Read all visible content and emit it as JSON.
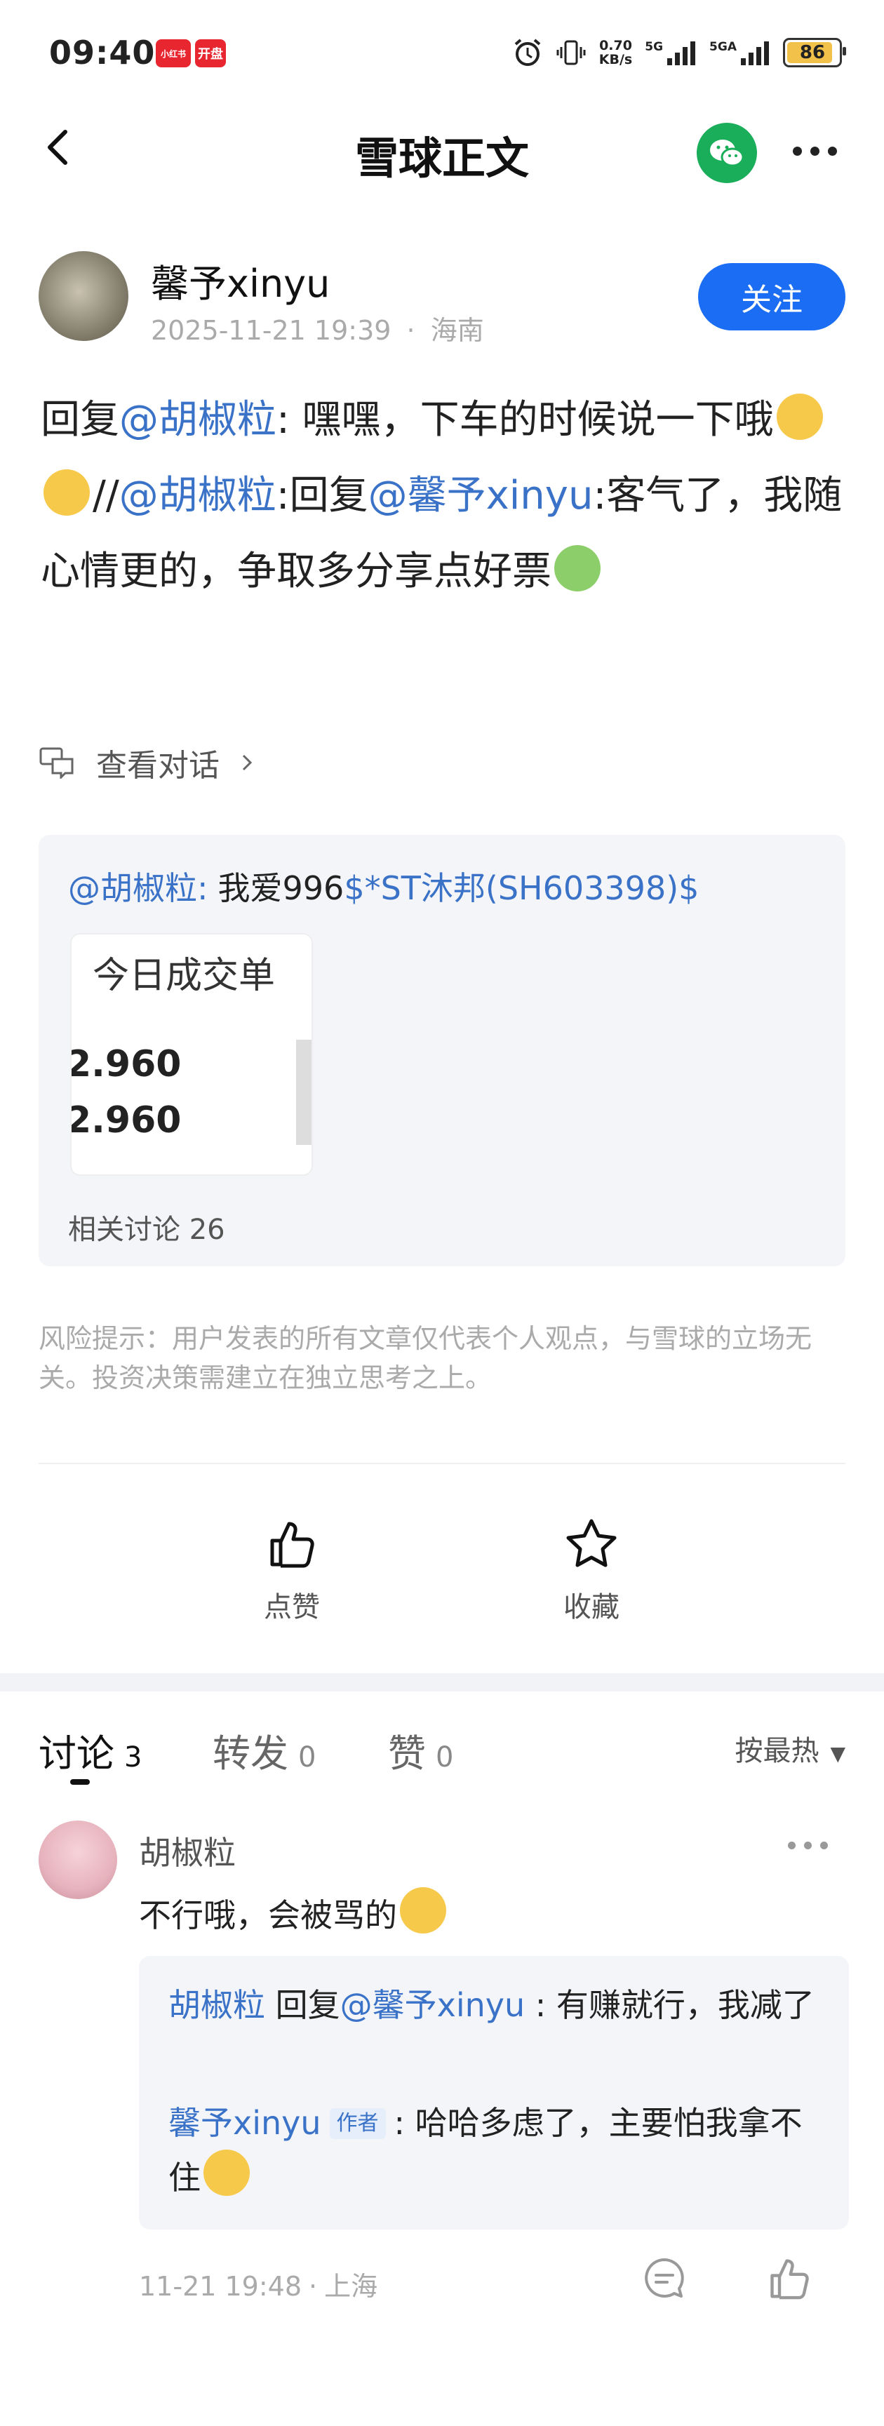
{
  "status_bar": {
    "time": "09:40",
    "badges": [
      "小红书",
      "开盘"
    ],
    "net_speed": "0.70",
    "net_unit": "KB/s",
    "sim1": "5G",
    "sim2": "5GA",
    "battery": "86",
    "battery_color": "#f2c14a"
  },
  "nav": {
    "title": "雪球正文"
  },
  "author": {
    "name": "馨予xinyu",
    "date": "2025-11-21 19:39",
    "location": "海南",
    "follow_label": "关注"
  },
  "post": {
    "p1": "回复",
    "m1": "@胡椒粒",
    "p2": ": 嘿嘿，下车的时候说一下哦",
    "p3": "//",
    "m2": "@胡椒粒",
    "p4": ":回复",
    "m3": "@馨予xinyu",
    "p5": ":客气了，我随心情更的，争取多分享点好票"
  },
  "view_conversation": "查看对话",
  "quote": {
    "mention": "@胡椒粒",
    "colon": ":",
    "text": "我爱996",
    "stock": "$*ST沐邦(SH603398)$",
    "image_title": "今日成交单",
    "image_rows": [
      "2.960",
      "2.960"
    ],
    "related": "相关讨论 26"
  },
  "risk_notice": "风险提示：用户发表的所有文章仅代表个人观点，与雪球的立场无关。投资决策需建立在独立思考之上。",
  "actions": {
    "like": "点赞",
    "favorite": "收藏"
  },
  "tabs": [
    {
      "label": "讨论",
      "count": "3"
    },
    {
      "label": "转发",
      "count": "0"
    },
    {
      "label": "赞",
      "count": "0"
    }
  ],
  "sort_label": "按最热",
  "comment": {
    "name": "胡椒粒",
    "text": "不行哦，会被骂的",
    "replies": [
      {
        "user": "胡椒粒",
        "verb": "回复",
        "target": "@馨予xinyu",
        "text": ": 有赚就行，我减了"
      },
      {
        "user": "馨予xinyu",
        "tag": "作者",
        "text": ": 哈哈多虑了，主要怕我拿不住"
      }
    ],
    "time": "11-21 19:48",
    "location": "上海"
  },
  "accent": "#1b6ef3",
  "link_color": "#3a72c8"
}
